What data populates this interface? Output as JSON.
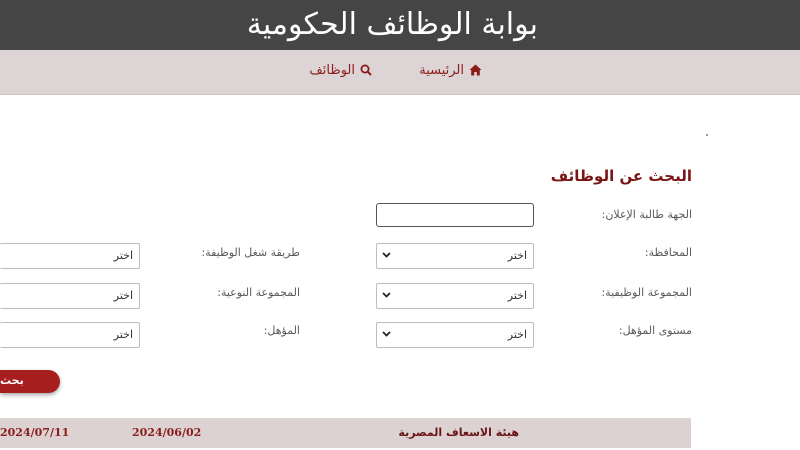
{
  "header": {
    "title": "بوابة الوظائف الحكومية"
  },
  "nav": {
    "items": [
      {
        "label": "الرئيسية",
        "icon": "home-icon"
      },
      {
        "label": "الوظائف",
        "icon": "search-icon"
      }
    ]
  },
  "search": {
    "heading": "البحث عن الوظائف",
    "fields": {
      "advertiser": {
        "label": "الجهة طالبة الإعلان:",
        "value": "",
        "placeholder": ""
      },
      "governorate": {
        "label": "المحافظة:",
        "value": "اختر"
      },
      "job_fill_method": {
        "label": "طريقة شغل الوظيفة:",
        "value": "اختر"
      },
      "job_group": {
        "label": "المجموعة الوظيفية:",
        "value": "اختر"
      },
      "qualitative_group": {
        "label": "المجموعة النوعية:",
        "value": "اختر"
      },
      "qualification_level": {
        "label": "مستوى المؤهل:",
        "value": "اختر"
      },
      "qualification": {
        "label": "المؤهل:",
        "value": "اختر"
      }
    },
    "button_label": "بحث"
  },
  "results": [
    {
      "organization": "هيئة الاسعاف المصرية",
      "start_date": "2024/06/02",
      "end_date": "2024/07/11"
    }
  ],
  "colors": {
    "header_bg": "#454545",
    "nav_bg": "#ddd5d5",
    "accent": "#8b1a1a",
    "button_bg": "#a61e1e",
    "row_bg": "#dcd2d2"
  }
}
